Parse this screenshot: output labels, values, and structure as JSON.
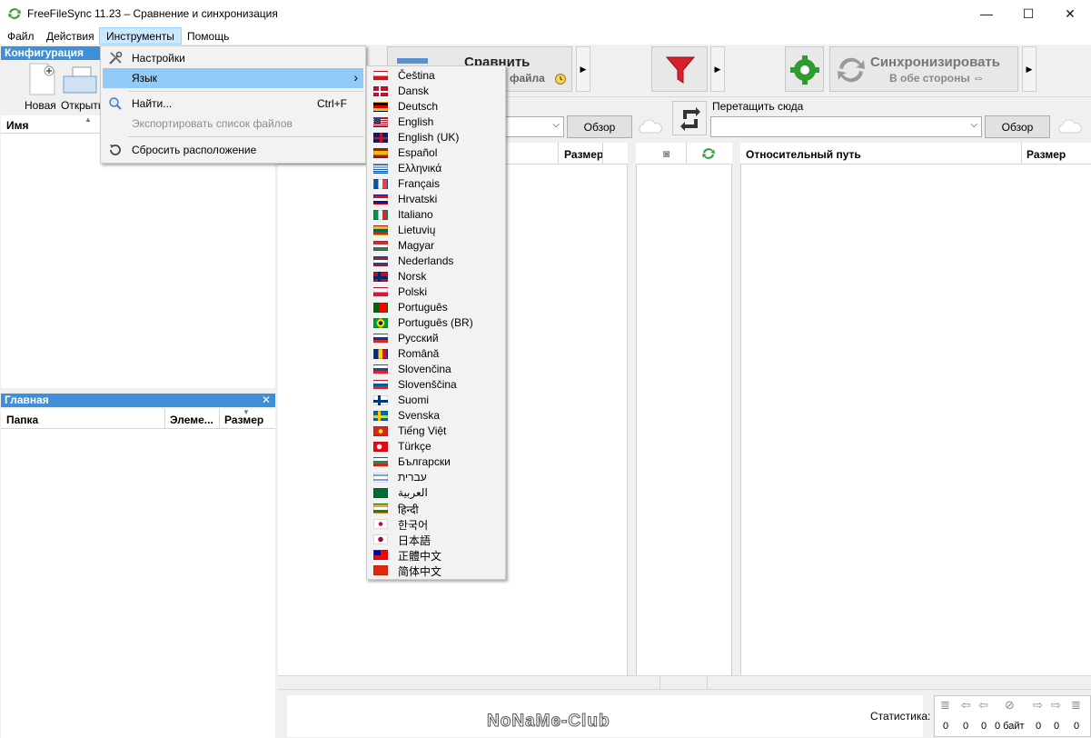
{
  "window": {
    "title": "FreeFileSync 11.23 – Сравнение и синхронизация",
    "minimize": "—",
    "maximize": "☐",
    "close": "✕"
  },
  "menubar": [
    "Файл",
    "Действия",
    "Инструменты",
    "Помощь"
  ],
  "config_panel": {
    "title": "Конфигурация",
    "new_label": "Новая",
    "open_label": "Открыть",
    "column_name": "Имя"
  },
  "main_panel": {
    "title": "Главная",
    "columns": [
      "Папка",
      "Элеме...",
      "Размер"
    ]
  },
  "toolbar": {
    "compare_label": "Сравнить",
    "compare_sub": "файла",
    "sync_label": "Синхронизировать",
    "sync_sub": "В обе стороны"
  },
  "folders": {
    "browse_left": "Обзор",
    "drop_hint": "Перетащить сюда",
    "browse_right": "Обзор"
  },
  "grid": {
    "left_size_col": "Размер",
    "right_path_col": "Относительный путь",
    "right_size_col": "Размер"
  },
  "tools_menu": {
    "items": [
      {
        "label": "Настройки",
        "shortcut": "",
        "icon": "wrench-screwdriver-icon"
      },
      {
        "label": "Язык",
        "shortcut": "›",
        "icon": ""
      },
      {
        "label": "Найти...",
        "shortcut": "Ctrl+F",
        "icon": "magnifier-icon"
      },
      {
        "label": "Экспортировать список файлов",
        "shortcut": "",
        "icon": ""
      },
      {
        "label": "Сбросить расположение",
        "shortcut": "",
        "icon": "reset-icon"
      }
    ]
  },
  "languages": [
    {
      "name": "Čeština",
      "flag": "cz"
    },
    {
      "name": "Dansk",
      "flag": "dk"
    },
    {
      "name": "Deutsch",
      "flag": "de"
    },
    {
      "name": "English",
      "flag": "us"
    },
    {
      "name": "English (UK)",
      "flag": "gb"
    },
    {
      "name": "Español",
      "flag": "es"
    },
    {
      "name": "Ελληνικά",
      "flag": "gr"
    },
    {
      "name": "Français",
      "flag": "fr"
    },
    {
      "name": "Hrvatski",
      "flag": "hr"
    },
    {
      "name": "Italiano",
      "flag": "it"
    },
    {
      "name": "Lietuvių",
      "flag": "lt"
    },
    {
      "name": "Magyar",
      "flag": "hu"
    },
    {
      "name": "Nederlands",
      "flag": "nl"
    },
    {
      "name": "Norsk",
      "flag": "no"
    },
    {
      "name": "Polski",
      "flag": "pl"
    },
    {
      "name": "Português",
      "flag": "pt"
    },
    {
      "name": "Português (BR)",
      "flag": "br"
    },
    {
      "name": "Русский",
      "flag": "ru"
    },
    {
      "name": "Română",
      "flag": "ro"
    },
    {
      "name": "Slovenčina",
      "flag": "sk"
    },
    {
      "name": "Slovenščina",
      "flag": "si"
    },
    {
      "name": "Suomi",
      "flag": "fi"
    },
    {
      "name": "Svenska",
      "flag": "se"
    },
    {
      "name": "Tiếng Việt",
      "flag": "vn"
    },
    {
      "name": "Türkçe",
      "flag": "tr"
    },
    {
      "name": "Български",
      "flag": "bg"
    },
    {
      "name": "עברית",
      "flag": "il"
    },
    {
      "name": "العربية",
      "flag": "sa"
    },
    {
      "name": "हिन्दी",
      "flag": "in"
    },
    {
      "name": "한국어",
      "flag": "kr"
    },
    {
      "name": "日本語",
      "flag": "jp"
    },
    {
      "name": "正體中文",
      "flag": "tw"
    },
    {
      "name": "简体中文",
      "flag": "cn"
    }
  ],
  "statusbar": {
    "stats_label": "Статистика:",
    "counts": [
      "0",
      "0",
      "0",
      "0 байт",
      "0",
      "0",
      "0"
    ],
    "watermark": "NoNaMe-Club"
  },
  "colors": {
    "accent": "#3e8fd8",
    "menu_highlight": "#91c9f7",
    "filter": "#d8202a",
    "settings": "#2e9b2e",
    "sync_arrows": "#3a9a3a"
  }
}
